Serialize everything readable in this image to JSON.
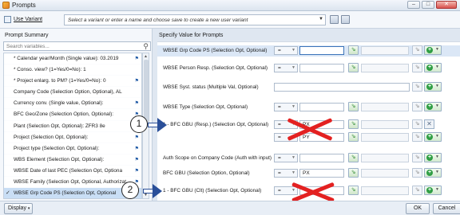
{
  "window": {
    "title": "Prompts"
  },
  "variant": {
    "label": "Use Variant",
    "placeholder": "Select a variant or enter a name and choose save to create a new user variant"
  },
  "summary": {
    "title": "Prompt Summary",
    "search_placeholder": "Search variables...",
    "items": [
      {
        "label": "* Calendar year/Month (Single value): 03.2019",
        "selected": false
      },
      {
        "label": "* Conso. view? (1=Yes/0=No): 1",
        "selected": false
      },
      {
        "label": "* Project enlarg. to PM? (1=Yes/0=No): 0",
        "selected": false
      },
      {
        "label": "Company Code (Selection Option, Optional), AL",
        "selected": false
      },
      {
        "label": "Currency conv. (Single value, Optional):",
        "selected": false
      },
      {
        "label": "BFC Geo/Zone (Selection Option, Optional):",
        "selected": false
      },
      {
        "label": "Plant (Selection Opt, Optional): ZFR3 8e",
        "selected": false
      },
      {
        "label": "Project (Selection Opt, Optional):",
        "selected": false
      },
      {
        "label": "Project type (Selection Opt, Optional):",
        "selected": false
      },
      {
        "label": "WBS Element (Selection Opt, Optional):",
        "selected": false
      },
      {
        "label": "WBSE Date of last PEC (Selection Opt, Optiona",
        "selected": false
      },
      {
        "label": "WBSE Family (Selection Opt, Optional, Authorizat",
        "selected": false
      },
      {
        "label": "WBSE Grp Code PS (Selection Opt, Optional",
        "selected": true
      }
    ]
  },
  "specify": {
    "title": "Specify Value for Prompts",
    "rows": [
      {
        "label": "WBSE Grp Code PS (Selection Opt, Optional)",
        "op": "=",
        "value": ""
      },
      {
        "label": "WBSE Person Resp. (Selection Opt, Optional)",
        "op": "=",
        "value": ""
      },
      {
        "label": "WBSE Syst. status (Multiple Val, Optional)",
        "op": "",
        "value": ""
      },
      {
        "label": "WBSE Type (Selection Opt, Optional)",
        "op": "=",
        "value": ""
      },
      {
        "label": "1 - BFC GBU (Resp.) (Selection Opt, Optional)",
        "op": "=",
        "value": "PX"
      },
      {
        "label": "",
        "op": "=",
        "value": "PY"
      },
      {
        "label": "Auth Scope on Company Code (Auth with input)",
        "op": "=",
        "value": ""
      },
      {
        "label": "BFC GBU (Selection Option, Optional)",
        "op": "=",
        "value": "PX"
      },
      {
        "label": "1 - BFC GBU (Clt) (Selection Opt, Optional)",
        "op": "=",
        "value": ""
      }
    ]
  },
  "annotations": {
    "marker_1": "1",
    "marker_2": "2"
  },
  "footer": {
    "display_label": "Display",
    "ok_label": "OK",
    "cancel_label": "Cancel"
  },
  "colors": {
    "highlight": "#dbe7f6",
    "selected_item": "#c9def5",
    "red_mark": "#e32121",
    "arrow": "#2a4f99"
  }
}
